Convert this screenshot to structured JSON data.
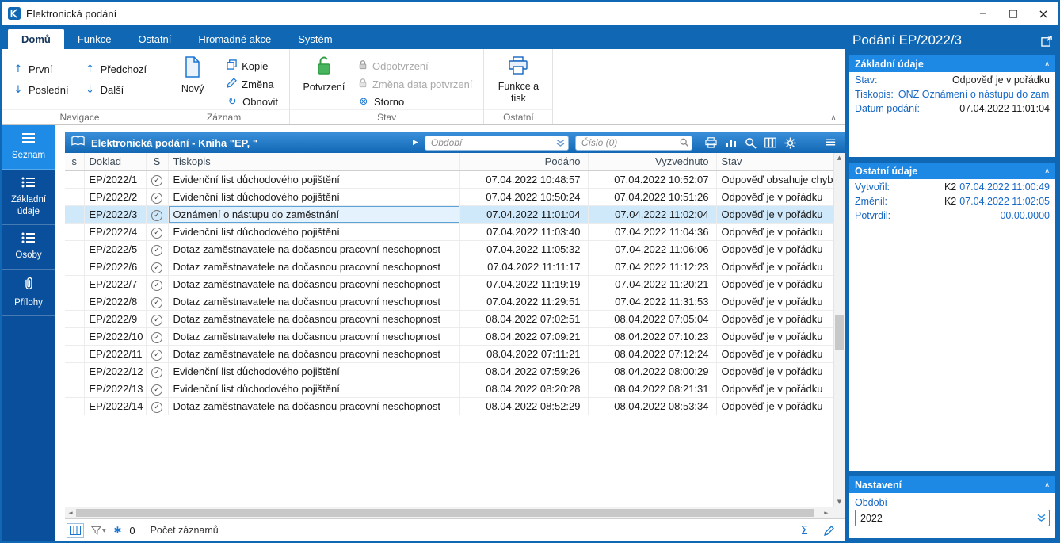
{
  "window": {
    "title": "Elektronická podání",
    "controls": {
      "minimize": "−",
      "maximize": "□",
      "close": "×"
    }
  },
  "icons": {
    "arrow_up": "↑",
    "arrow_down": "↓",
    "refresh": "↻",
    "storno": "⊗",
    "check": "✓",
    "menu": "≡",
    "play": "▶",
    "sum": "Σ",
    "chevron_up": "∧",
    "asterisk": "∗",
    "scroll_up": "▲",
    "scroll_down": "▼",
    "scroll_left": "◄",
    "scroll_right": "►"
  },
  "ribbon": {
    "tabs": [
      "Domů",
      "Funkce",
      "Ostatní",
      "Hromadné akce",
      "Systém"
    ],
    "navigace": {
      "group": "Navigace",
      "first": "První",
      "last": "Poslední",
      "prev": "Předchozí",
      "next": "Další"
    },
    "zaznam": {
      "group": "Záznam",
      "new": "Nový",
      "copy": "Kopie",
      "edit": "Změna",
      "refresh": "Obnovit"
    },
    "stav": {
      "group": "Stav",
      "confirm": "Potvrzení",
      "unconfirm": "Odpotvrzení",
      "change_date": "Změna data potvrzení",
      "cancel": "Storno"
    },
    "ostatni": {
      "group": "Ostatní",
      "func_print": "Funkce a tisk"
    }
  },
  "sidebar": {
    "items": [
      {
        "label": "Seznam"
      },
      {
        "label": "Základní údaje"
      },
      {
        "label": "Osoby"
      },
      {
        "label": "Přílohy"
      }
    ]
  },
  "main": {
    "header": {
      "title": "Elektronická podání - Kniha \"EP, \"",
      "obdobi_placeholder": "Období",
      "cislo_placeholder": "Číslo (0)"
    },
    "table": {
      "columns": [
        "s",
        "Doklad",
        "S",
        "Tiskopis",
        "Podáno",
        "Vyzvednuto",
        "Stav"
      ],
      "selected_index": 2,
      "rows": [
        {
          "doklad": "EP/2022/1",
          "tiskopis": "Evidenční list důchodového pojištění",
          "podano": "07.04.2022 10:48:57",
          "vyzvednuto": "07.04.2022 10:52:07",
          "stav": "Odpověď obsahuje chybu"
        },
        {
          "doklad": "EP/2022/2",
          "tiskopis": "Evidenční list důchodového pojištění",
          "podano": "07.04.2022 10:50:24",
          "vyzvednuto": "07.04.2022 10:51:26",
          "stav": "Odpověď je v pořádku"
        },
        {
          "doklad": "EP/2022/3",
          "tiskopis": "Oznámení o nástupu do zaměstnání",
          "podano": "07.04.2022 11:01:04",
          "vyzvednuto": "07.04.2022 11:02:04",
          "stav": "Odpověď je v pořádku"
        },
        {
          "doklad": "EP/2022/4",
          "tiskopis": "Evidenční list důchodového pojištění",
          "podano": "07.04.2022 11:03:40",
          "vyzvednuto": "07.04.2022 11:04:36",
          "stav": "Odpověď je v pořádku"
        },
        {
          "doklad": "EP/2022/5",
          "tiskopis": "Dotaz zaměstnavatele na dočasnou pracovní neschopnost",
          "podano": "07.04.2022 11:05:32",
          "vyzvednuto": "07.04.2022 11:06:06",
          "stav": "Odpověď je v pořádku"
        },
        {
          "doklad": "EP/2022/6",
          "tiskopis": "Dotaz zaměstnavatele na dočasnou pracovní neschopnost",
          "podano": "07.04.2022 11:11:17",
          "vyzvednuto": "07.04.2022 11:12:23",
          "stav": "Odpověď je v pořádku"
        },
        {
          "doklad": "EP/2022/7",
          "tiskopis": "Dotaz zaměstnavatele na dočasnou pracovní neschopnost",
          "podano": "07.04.2022 11:19:19",
          "vyzvednuto": "07.04.2022 11:20:21",
          "stav": "Odpověď je v pořádku"
        },
        {
          "doklad": "EP/2022/8",
          "tiskopis": "Dotaz zaměstnavatele na dočasnou pracovní neschopnost",
          "podano": "07.04.2022 11:29:51",
          "vyzvednuto": "07.04.2022 11:31:53",
          "stav": "Odpověď je v pořádku"
        },
        {
          "doklad": "EP/2022/9",
          "tiskopis": "Dotaz zaměstnavatele na dočasnou pracovní neschopnost",
          "podano": "08.04.2022 07:02:51",
          "vyzvednuto": "08.04.2022 07:05:04",
          "stav": "Odpověď je v pořádku"
        },
        {
          "doklad": "EP/2022/10",
          "tiskopis": "Dotaz zaměstnavatele na dočasnou pracovní neschopnost",
          "podano": "08.04.2022 07:09:21",
          "vyzvednuto": "08.04.2022 07:10:23",
          "stav": "Odpověď je v pořádku"
        },
        {
          "doklad": "EP/2022/11",
          "tiskopis": "Dotaz zaměstnavatele na dočasnou pracovní neschopnost",
          "podano": "08.04.2022 07:11:21",
          "vyzvednuto": "08.04.2022 07:12:24",
          "stav": "Odpověď je v pořádku"
        },
        {
          "doklad": "EP/2022/12",
          "tiskopis": "Evidenční list důchodového pojištění",
          "podano": "08.04.2022 07:59:26",
          "vyzvednuto": "08.04.2022 08:00:29",
          "stav": "Odpověď je v pořádku"
        },
        {
          "doklad": "EP/2022/13",
          "tiskopis": "Evidenční list důchodového pojištění",
          "podano": "08.04.2022 08:20:28",
          "vyzvednuto": "08.04.2022 08:21:31",
          "stav": "Odpověď je v pořádku"
        },
        {
          "doklad": "EP/2022/14",
          "tiskopis": "Dotaz zaměstnavatele na dočasnou pracovní neschopnost",
          "podano": "08.04.2022 08:52:29",
          "vyzvednuto": "08.04.2022 08:53:34",
          "stav": "Odpověď je v pořádku"
        }
      ]
    },
    "statusbar": {
      "flag_count": "0",
      "count_label": "Počet záznamů"
    }
  },
  "panel": {
    "title": "Podání EP/2022/3",
    "zakladni": {
      "header": "Základní údaje",
      "rows": [
        {
          "label": "Stav:",
          "value": "Odpověď je v pořádku"
        },
        {
          "label": "Tiskopis:",
          "value": "ONZ Oznámení o nástupu do zam..."
        },
        {
          "label": "Datum podání:",
          "value": "07.04.2022 11:01:04"
        }
      ]
    },
    "ostatni": {
      "header": "Ostatní údaje",
      "rows": [
        {
          "label": "Vytvořil:",
          "user": "K2",
          "date": "07.04.2022 11:00:49"
        },
        {
          "label": "Změnil:",
          "user": "K2",
          "date": "07.04.2022 11:02:05"
        },
        {
          "label": "Potvrdil:",
          "user": "",
          "date": "00.00.0000"
        }
      ]
    },
    "nastaveni": {
      "header": "Nastavení",
      "obdobi_label": "Období",
      "obdobi_value": "2022"
    }
  }
}
